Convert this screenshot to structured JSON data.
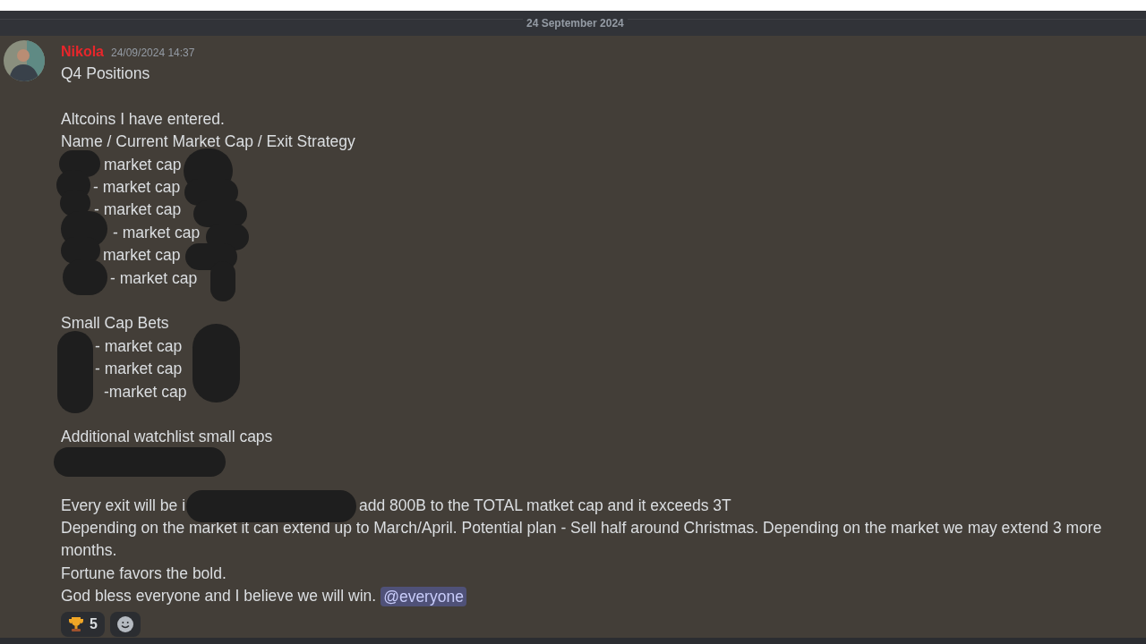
{
  "date_divider": "24 September 2024",
  "message": {
    "author": "Nikola",
    "timestamp": "24/09/2024 14:37",
    "lines": [
      {
        "kind": "text",
        "text": "Q4 Positions"
      },
      {
        "kind": "blank"
      },
      {
        "kind": "text",
        "text": "Altcoins I have entered."
      },
      {
        "kind": "text",
        "text": "Name / Current Market Cap / Exit Strategy"
      },
      {
        "kind": "redacted",
        "text": "market cap"
      },
      {
        "kind": "redacted",
        "text": "- market cap"
      },
      {
        "kind": "redacted",
        "text": "- market cap"
      },
      {
        "kind": "redacted",
        "text": "- market cap"
      },
      {
        "kind": "redacted",
        "text": "market cap"
      },
      {
        "kind": "redacted",
        "text": "- market cap"
      },
      {
        "kind": "blank"
      },
      {
        "kind": "text",
        "text": "Small Cap Bets"
      },
      {
        "kind": "redacted",
        "text": "- market cap"
      },
      {
        "kind": "redacted",
        "text": "- market cap"
      },
      {
        "kind": "redacted",
        "text": "-market cap"
      },
      {
        "kind": "blank"
      },
      {
        "kind": "text",
        "text": "Additional watchlist small caps"
      },
      {
        "kind": "redacted_full"
      },
      {
        "kind": "blank"
      },
      {
        "kind": "split",
        "parts": [
          "Every exit will be i",
          "add 800B to the TOTAL matket cap and it exceeds 3T"
        ]
      },
      {
        "kind": "text",
        "text": "Depending on the market it can extend up to March/April. Potential plan - Sell half around Christmas. Depending on the market we may extend 3 more months."
      },
      {
        "kind": "text",
        "text": "Fortune favors the bold."
      },
      {
        "kind": "mention_line",
        "text": "God bless everyone and I believe we will win.",
        "mention": "@everyone"
      }
    ],
    "reactions": [
      {
        "kind": "trophy",
        "count": "5"
      },
      {
        "kind": "add"
      }
    ]
  }
}
